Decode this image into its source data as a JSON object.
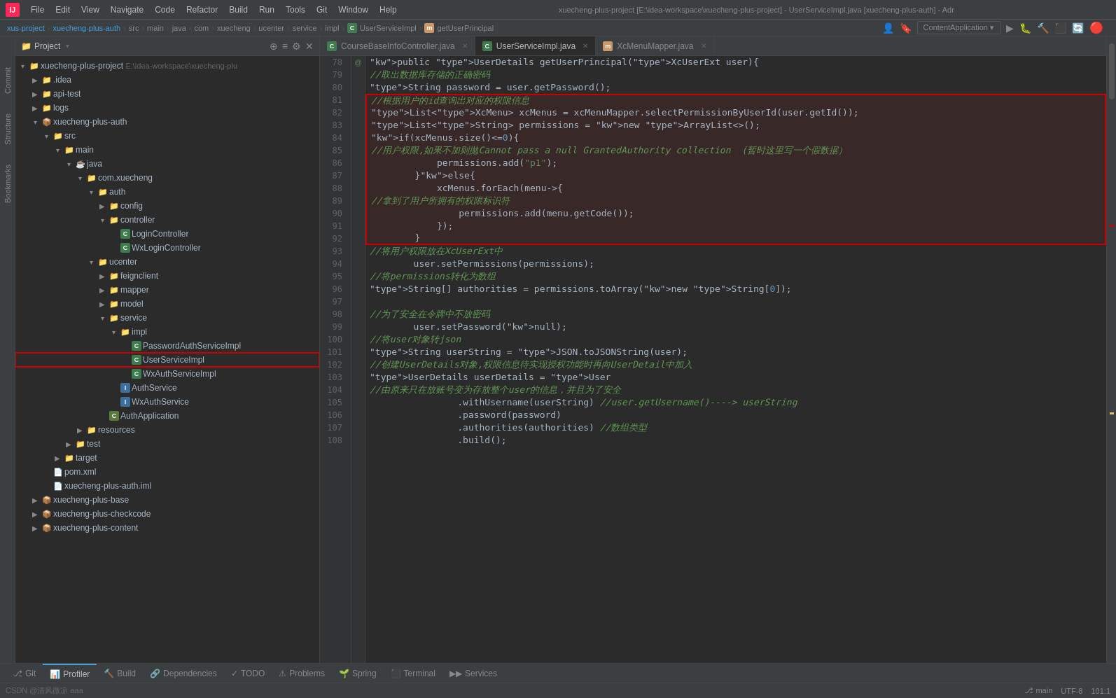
{
  "window_title": "xuecheng-plus-project [E:\\idea-workspace\\xuecheng-plus-project] - UserServiceImpl.java [xuecheng-plus-auth] - Adr",
  "menu": {
    "items": [
      "File",
      "Edit",
      "View",
      "Navigate",
      "Code",
      "Refactor",
      "Build",
      "Run",
      "Tools",
      "Git",
      "Window",
      "Help"
    ]
  },
  "breadcrumb": {
    "parts": [
      "xus-project",
      "xuecheng-plus-auth",
      "src",
      "main",
      "java",
      "com",
      "xuecheng",
      "ucenter",
      "service",
      "impl",
      "UserServiceImpl",
      "getUserPrincipal"
    ]
  },
  "tabs": [
    {
      "name": "CourseBaseInfoController.java",
      "icon": "C",
      "active": false
    },
    {
      "name": "UserServiceImpl.java",
      "icon": "C",
      "active": true
    },
    {
      "name": "XcMenuMapper.java",
      "icon": "M",
      "active": false
    }
  ],
  "sidebar": {
    "title": "Project",
    "tree": [
      {
        "level": 0,
        "type": "folder",
        "label": "xuecheng-plus-project",
        "suffix": "E:\\idea-workspace\\xuecheng-plu",
        "expanded": true
      },
      {
        "level": 1,
        "type": "folder",
        "label": ".idea",
        "expanded": false
      },
      {
        "level": 1,
        "type": "folder",
        "label": "api-test",
        "expanded": false
      },
      {
        "level": 1,
        "type": "folder",
        "label": "logs",
        "expanded": false
      },
      {
        "level": 1,
        "type": "folder-module",
        "label": "xuecheng-plus-auth",
        "expanded": true
      },
      {
        "level": 2,
        "type": "folder",
        "label": "src",
        "expanded": true
      },
      {
        "level": 3,
        "type": "folder",
        "label": "main",
        "expanded": true
      },
      {
        "level": 4,
        "type": "folder",
        "label": "java",
        "expanded": true
      },
      {
        "level": 5,
        "type": "folder",
        "label": "com.xuecheng",
        "expanded": true
      },
      {
        "level": 6,
        "type": "folder",
        "label": "auth",
        "expanded": true
      },
      {
        "level": 7,
        "type": "folder",
        "label": "config",
        "expanded": false
      },
      {
        "level": 7,
        "type": "folder",
        "label": "controller",
        "expanded": true
      },
      {
        "level": 8,
        "type": "class",
        "label": "LoginController",
        "expanded": false
      },
      {
        "level": 8,
        "type": "class",
        "label": "WxLoginController",
        "expanded": false
      },
      {
        "level": 6,
        "type": "folder",
        "label": "ucenter",
        "expanded": true
      },
      {
        "level": 7,
        "type": "folder",
        "label": "feignclient",
        "expanded": false
      },
      {
        "level": 7,
        "type": "folder",
        "label": "mapper",
        "expanded": false
      },
      {
        "level": 7,
        "type": "folder",
        "label": "model",
        "expanded": false
      },
      {
        "level": 7,
        "type": "folder",
        "label": "service",
        "expanded": true
      },
      {
        "level": 8,
        "type": "folder",
        "label": "impl",
        "expanded": true
      },
      {
        "level": 9,
        "type": "class",
        "label": "PasswordAuthServiceImpl",
        "expanded": false
      },
      {
        "level": 9,
        "type": "class",
        "label": "UserServiceImpl",
        "expanded": false,
        "selected": true
      },
      {
        "level": 9,
        "type": "class",
        "label": "WxAuthServiceImpl",
        "expanded": false
      },
      {
        "level": 8,
        "type": "interface",
        "label": "AuthService",
        "expanded": false
      },
      {
        "level": 8,
        "type": "interface",
        "label": "WxAuthService",
        "expanded": false
      },
      {
        "level": 7,
        "type": "class",
        "label": "AuthApplication",
        "expanded": false
      },
      {
        "level": 5,
        "type": "folder",
        "label": "resources",
        "expanded": false
      },
      {
        "level": 4,
        "type": "folder",
        "label": "test",
        "expanded": false
      },
      {
        "level": 3,
        "type": "folder",
        "label": "target",
        "expanded": false
      },
      {
        "level": 2,
        "type": "xml",
        "label": "pom.xml",
        "expanded": false
      },
      {
        "level": 2,
        "type": "iml",
        "label": "xuecheng-plus-auth.iml",
        "expanded": false
      },
      {
        "level": 1,
        "type": "folder-module",
        "label": "xuecheng-plus-base",
        "expanded": false
      },
      {
        "level": 1,
        "type": "folder-module",
        "label": "xuecheng-plus-checkcode",
        "expanded": false
      },
      {
        "level": 1,
        "type": "folder-module",
        "label": "xuecheng-plus-content",
        "expanded": false
      }
    ]
  },
  "code_lines": [
    {
      "num": 78,
      "gutter": "@",
      "content": "    public UserDetails getUserPrincipal(XcUserExt user){",
      "highlight": false
    },
    {
      "num": 79,
      "gutter": "",
      "content": "        //取出数据库存储的正确密码",
      "highlight": false
    },
    {
      "num": 80,
      "gutter": "",
      "content": "        String password = user.getPassword();",
      "highlight": false
    },
    {
      "num": 81,
      "gutter": "",
      "content": "        //根据用户的id查询出对应的权限信息",
      "highlight": true
    },
    {
      "num": 82,
      "gutter": "",
      "content": "        List<XcMenu> xcMenus = xcMenuMapper.selectPermissionByUserId(user.getId());",
      "highlight": true
    },
    {
      "num": 83,
      "gutter": "",
      "content": "        List<String> permissions = new ArrayList<>();",
      "highlight": true
    },
    {
      "num": 84,
      "gutter": "",
      "content": "        if(xcMenus.size()<=0){",
      "highlight": true
    },
    {
      "num": 85,
      "gutter": "",
      "content": "            //用户权限,如果不加则抛Cannot pass a null GrantedAuthority collection  (暂时这里写一个假数据）",
      "highlight": true
    },
    {
      "num": 86,
      "gutter": "",
      "content": "            permissions.add(\"p1\");",
      "highlight": true
    },
    {
      "num": 87,
      "gutter": "",
      "content": "        }else{",
      "highlight": true
    },
    {
      "num": 88,
      "gutter": "",
      "content": "            xcMenus.forEach(menu->{",
      "highlight": true
    },
    {
      "num": 89,
      "gutter": "",
      "content": "                //拿到了用户所拥有的权限标识符",
      "highlight": true
    },
    {
      "num": 90,
      "gutter": "",
      "content": "                permissions.add(menu.getCode());",
      "highlight": true
    },
    {
      "num": 91,
      "gutter": "",
      "content": "            });",
      "highlight": true
    },
    {
      "num": 92,
      "gutter": "",
      "content": "        }",
      "highlight": true
    },
    {
      "num": 93,
      "gutter": "",
      "content": "        //将用户权限放在XcUserExt中",
      "highlight": false
    },
    {
      "num": 94,
      "gutter": "",
      "content": "        user.setPermissions(permissions);",
      "highlight": false
    },
    {
      "num": 95,
      "gutter": "",
      "content": "        //将permissions转化为数组",
      "highlight": false
    },
    {
      "num": 96,
      "gutter": "",
      "content": "        String[] authorities = permissions.toArray(new String[0]);",
      "highlight": false
    },
    {
      "num": 97,
      "gutter": "",
      "content": "",
      "highlight": false
    },
    {
      "num": 98,
      "gutter": "",
      "content": "        //为了安全在令牌中不放密码",
      "highlight": false
    },
    {
      "num": 99,
      "gutter": "",
      "content": "        user.setPassword(null);",
      "highlight": false
    },
    {
      "num": 100,
      "gutter": "",
      "content": "        //将user对象转json",
      "highlight": false
    },
    {
      "num": 101,
      "gutter": "",
      "content": "        String userString = JSON.toJSONString(user);",
      "highlight": false
    },
    {
      "num": 102,
      "gutter": "",
      "content": "        //创建UserDetails对象,权限信息待实现授权功能时再向UserDetail中加入",
      "highlight": false
    },
    {
      "num": 103,
      "gutter": "",
      "content": "        UserDetails userDetails = User",
      "highlight": false
    },
    {
      "num": 104,
      "gutter": "",
      "content": "                //由原来只在放账号变为存放整个user的信息，并且为了安全",
      "highlight": false
    },
    {
      "num": 105,
      "gutter": "",
      "content": "                .withUsername(userString) //user.getUsername()----> userString",
      "highlight": false
    },
    {
      "num": 106,
      "gutter": "",
      "content": "                .password(password)",
      "highlight": false
    },
    {
      "num": 107,
      "gutter": "",
      "content": "                .authorities(authorities) //数组类型",
      "highlight": false
    },
    {
      "num": 108,
      "gutter": "",
      "content": "                .build();",
      "highlight": false
    }
  ],
  "bottom_tabs": [
    {
      "label": "Git",
      "icon": "git"
    },
    {
      "label": "Profiler",
      "icon": "profiler"
    },
    {
      "label": "Build",
      "icon": "build"
    },
    {
      "label": "Dependencies",
      "icon": "deps"
    },
    {
      "label": "TODO",
      "icon": "todo"
    },
    {
      "label": "Problems",
      "icon": "problems"
    },
    {
      "label": "Spring",
      "icon": "spring"
    },
    {
      "label": "Terminal",
      "icon": "terminal"
    },
    {
      "label": "Services",
      "icon": "services"
    }
  ],
  "status_bar": {
    "watermark": "CSDN @清风微凉 aaa",
    "encoding": "UTF-8",
    "line_col": "101:1"
  },
  "left_labels": [
    "Commit",
    "Structure",
    "Bookmarks"
  ]
}
